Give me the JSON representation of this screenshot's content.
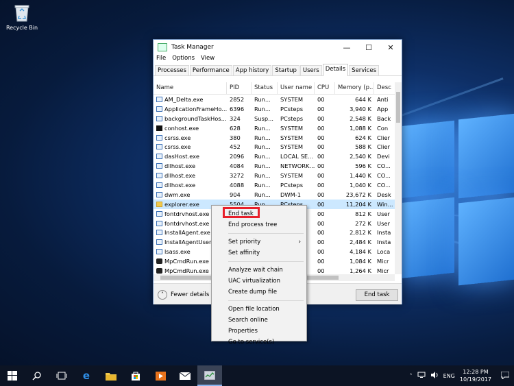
{
  "desktop": {
    "recycle_bin_label": "Recycle Bin"
  },
  "window": {
    "title": "Task Manager",
    "controls": {
      "minimize": "—",
      "maximize": "☐",
      "close": "✕"
    },
    "menu": [
      "File",
      "Options",
      "View"
    ],
    "tabs": [
      "Processes",
      "Performance",
      "App history",
      "Startup",
      "Users",
      "Details",
      "Services"
    ],
    "active_tab": "Details",
    "columns": [
      "Name",
      "PID",
      "Status",
      "User name",
      "CPU",
      "Memory (p...",
      "Desc"
    ],
    "rows": [
      {
        "name": "AM_Delta.exe",
        "pid": "2852",
        "status": "Run...",
        "user": "SYSTEM",
        "cpu": "00",
        "mem": "644 K",
        "desc": "Anti"
      },
      {
        "name": "ApplicationFrameHo...",
        "pid": "6396",
        "status": "Run...",
        "user": "PCsteps",
        "cpu": "00",
        "mem": "3,940 K",
        "desc": "App"
      },
      {
        "name": "backgroundTaskHos...",
        "pid": "324",
        "status": "Susp...",
        "user": "PCsteps",
        "cpu": "00",
        "mem": "2,548 K",
        "desc": "Back"
      },
      {
        "name": "conhost.exe",
        "pid": "628",
        "status": "Run...",
        "user": "SYSTEM",
        "cpu": "00",
        "mem": "1,088 K",
        "desc": "Con"
      },
      {
        "name": "csrss.exe",
        "pid": "380",
        "status": "Run...",
        "user": "SYSTEM",
        "cpu": "00",
        "mem": "624 K",
        "desc": "Clier"
      },
      {
        "name": "csrss.exe",
        "pid": "452",
        "status": "Run...",
        "user": "SYSTEM",
        "cpu": "00",
        "mem": "588 K",
        "desc": "Clier"
      },
      {
        "name": "dasHost.exe",
        "pid": "2096",
        "status": "Run...",
        "user": "LOCAL SE...",
        "cpu": "00",
        "mem": "2,540 K",
        "desc": "Devi"
      },
      {
        "name": "dllhost.exe",
        "pid": "4084",
        "status": "Run...",
        "user": "NETWORK...",
        "cpu": "00",
        "mem": "596 K",
        "desc": "CO..."
      },
      {
        "name": "dllhost.exe",
        "pid": "3272",
        "status": "Run...",
        "user": "SYSTEM",
        "cpu": "00",
        "mem": "1,440 K",
        "desc": "CO..."
      },
      {
        "name": "dllhost.exe",
        "pid": "4088",
        "status": "Run...",
        "user": "PCsteps",
        "cpu": "00",
        "mem": "1,040 K",
        "desc": "CO..."
      },
      {
        "name": "dwm.exe",
        "pid": "904",
        "status": "Run...",
        "user": "DWM-1",
        "cpu": "00",
        "mem": "23,672 K",
        "desc": "Desk"
      },
      {
        "name": "explorer.exe",
        "pid": "5504",
        "status": "Run...",
        "user": "PCsteps",
        "cpu": "00",
        "mem": "11,204 K",
        "desc": "Win..."
      },
      {
        "name": "fontdrvhost.exe",
        "pid": "",
        "status": "",
        "user": "",
        "cpu": "00",
        "mem": "812 K",
        "desc": "User"
      },
      {
        "name": "fontdrvhost.exe",
        "pid": "",
        "status": "",
        "user": "",
        "cpu": "00",
        "mem": "272 K",
        "desc": "User"
      },
      {
        "name": "InstallAgent.exe",
        "pid": "",
        "status": "",
        "user": "",
        "cpu": "00",
        "mem": "2,812 K",
        "desc": "Insta"
      },
      {
        "name": "InstallAgentUserB...",
        "pid": "",
        "status": "",
        "user": "",
        "cpu": "00",
        "mem": "2,484 K",
        "desc": "Insta"
      },
      {
        "name": "lsass.exe",
        "pid": "",
        "status": "",
        "user": "",
        "cpu": "00",
        "mem": "4,184 K",
        "desc": "Loca"
      },
      {
        "name": "MpCmdRun.exe",
        "pid": "",
        "status": "",
        "user": "...",
        "cpu": "00",
        "mem": "1,084 K",
        "desc": "Micr"
      },
      {
        "name": "MpCmdRun.exe",
        "pid": "",
        "status": "",
        "user": "...",
        "cpu": "00",
        "mem": "1,264 K",
        "desc": "Micr"
      }
    ],
    "footer": {
      "fewer_details": "Fewer details",
      "end_task": "End task"
    }
  },
  "context_menu": {
    "items": [
      "End task",
      "End process tree",
      "Set priority",
      "Set affinity",
      "Analyze wait chain",
      "UAC virtualization",
      "Create dump file",
      "Open file location",
      "Search online",
      "Properties",
      "Go to service(s)"
    ],
    "highlight_color": "#e8202a"
  },
  "taskbar": {
    "language": "ENG",
    "time": "12:28 PM",
    "date": "10/19/2017"
  }
}
